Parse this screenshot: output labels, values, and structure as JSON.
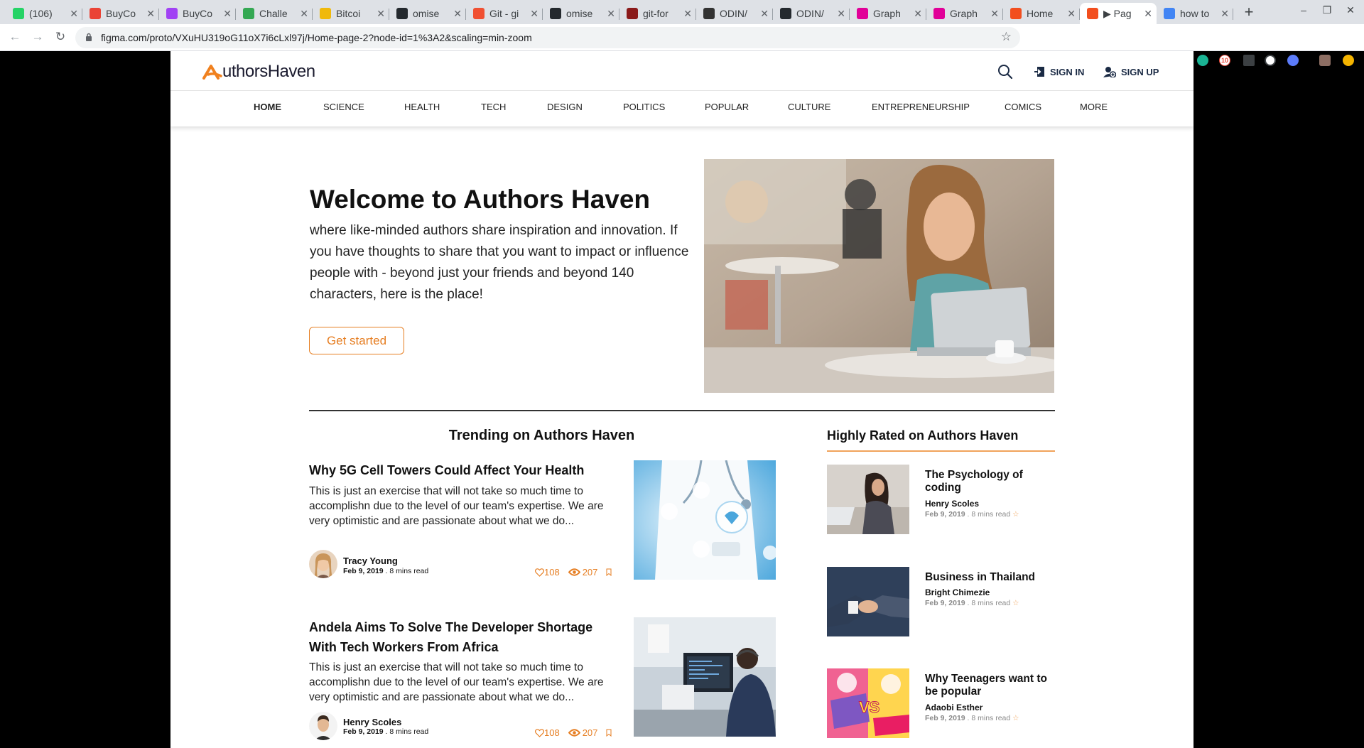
{
  "browser": {
    "tabs": [
      {
        "title": "(106)",
        "icon": "whatsapp-icon",
        "color": "#25d366"
      },
      {
        "title": "BuyCo",
        "icon": "gmail-icon",
        "color": "#ea4335"
      },
      {
        "title": "BuyCo",
        "icon": "circle-icon",
        "color": "#a142f4"
      },
      {
        "title": "Challe",
        "icon": "challenge-icon",
        "color": "#34a853"
      },
      {
        "title": "Bitcoi",
        "icon": "binance-icon",
        "color": "#f0b90b"
      },
      {
        "title": "omise",
        "icon": "github-icon",
        "color": "#24292e"
      },
      {
        "title": "Git - gi",
        "icon": "git-icon",
        "color": "#f05032"
      },
      {
        "title": "omise",
        "icon": "github-icon",
        "color": "#24292e"
      },
      {
        "title": "git-for",
        "icon": "c-icon",
        "color": "#8b1a1a"
      },
      {
        "title": "ODIN/",
        "icon": "odin-icon",
        "color": "#333333"
      },
      {
        "title": "ODIN/",
        "icon": "github-icon",
        "color": "#24292e"
      },
      {
        "title": "Graph",
        "icon": "graphql-icon",
        "color": "#e10098"
      },
      {
        "title": "Graph",
        "icon": "graphql-icon",
        "color": "#e10098"
      },
      {
        "title": "Home",
        "icon": "figma-icon",
        "color": "#f24e1e"
      },
      {
        "title": "▶ Pag",
        "icon": "figma-icon",
        "color": "#f24e1e",
        "active": true
      },
      {
        "title": "how to",
        "icon": "google-icon",
        "color": "#4285f4"
      }
    ],
    "url": "figma.com/proto/VXuHU319oG11oX7i6cLxl97j/Home-page-2?node-id=1%3A2&scaling=min-zoom",
    "badge": "10"
  },
  "site": {
    "logo_prefix": "uthors",
    "logo_suffix": "Haven",
    "sign_in": "SIGN IN",
    "sign_up": "SIGN UP",
    "nav": [
      "HOME",
      "SCIENCE",
      "HEALTH",
      "TECH",
      "DESIGN",
      "POLITICS",
      "POPULAR",
      "CULTURE",
      "ENTREPRENEURSHIP",
      "COMICS",
      "MORE"
    ],
    "active_nav": "HOME",
    "accent": "#e67e22"
  },
  "hero": {
    "title": "Welcome to Authors Haven",
    "text": "where like-minded authors share inspiration and innovation. If you have thoughts to share that you want to impact or influence people with - beyond just your friends and beyond 140 characters, here is the place!",
    "button": "Get started"
  },
  "trending": {
    "title": "Trending on Authors Haven",
    "articles": [
      {
        "title": "Why 5G Cell Towers Could Affect Your Health",
        "body": "This is just an exercise that will not take so much time to accomplishn due to the level of our team's expertise. We are very optimistic and are passionate about what we do...",
        "author": "Tracy Young",
        "date": "Feb 9, 2019",
        "read": ". 8 mins read",
        "likes": "108",
        "views": "207"
      },
      {
        "title": "Andela Aims To Solve The Developer Shortage With Tech Workers From Africa",
        "body": "This is just an exercise that will not take so much time to accomplishn due to the level of our team's expertise. We are very optimistic and are passionate about what we do...",
        "author": "Henry Scoles",
        "date": "Feb 9, 2019",
        "read": ". 8 mins read",
        "likes": "108",
        "views": "207"
      }
    ]
  },
  "rated": {
    "title": "Highly Rated on Authors Haven",
    "items": [
      {
        "title": "The Psychology of coding",
        "author": "Henry Scoles",
        "date": "Feb 9, 2019",
        "read": ". 8 mins read"
      },
      {
        "title": "Business in Thailand",
        "author": "Bright Chimezie",
        "date": "Feb 9, 2019",
        "read": ". 8 mins read"
      },
      {
        "title": "Why Teenagers want to be popular",
        "author": "Adaobi Esther",
        "date": "Feb 9, 2019",
        "read": ". 8 mins read"
      }
    ]
  }
}
